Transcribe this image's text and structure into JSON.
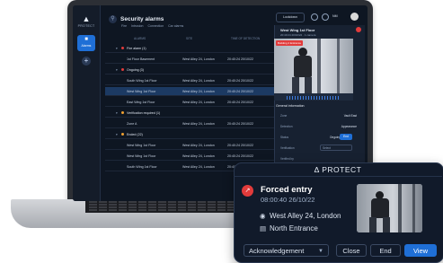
{
  "app": {
    "brand": "PROTECT"
  },
  "rail": {
    "alarms_label": "Alarms",
    "add_symbol": "+"
  },
  "list": {
    "title": "Security alarms",
    "legend": [
      "Fire",
      "Intrusion",
      "Connection",
      "Car alarms"
    ],
    "columns": [
      "ALARMS",
      "SITE",
      "TIME OF DETECTION",
      "STATUS"
    ],
    "rows": [
      {
        "kind": "group",
        "label": "Fire alarm (1)"
      },
      {
        "kind": "item",
        "name": "1st Floor Basement",
        "site": "West Alley 24, London",
        "time": "20:40:24 20/10/22"
      },
      {
        "kind": "group",
        "label": "Ongoing (3)"
      },
      {
        "kind": "item",
        "name": "South Wing 1st Floor",
        "site": "West Alley 24, London",
        "time": "20:40:24 20/10/22"
      },
      {
        "kind": "item",
        "name": "West Wing 1st Floor",
        "site": "West Alley 24, London",
        "time": "20:40:24 20/10/22",
        "selected": true
      },
      {
        "kind": "item",
        "name": "East Wing 1st Floor",
        "site": "West Alley 24, London",
        "time": "20:40:24 20/10/22"
      },
      {
        "kind": "group",
        "label": "Verification required (1)"
      },
      {
        "kind": "item",
        "name": "Zone A",
        "site": "West Alley 24, London",
        "time": "20:40:24 20/10/22"
      },
      {
        "kind": "group",
        "label": "Ended (22)"
      },
      {
        "kind": "item",
        "name": "West Wing 1st Floor",
        "site": "West Alley 24, London",
        "time": "20:40:24 20/10/22"
      },
      {
        "kind": "item",
        "name": "West Wing 1st Floor",
        "site": "West Alley 24, London",
        "time": "20:40:24 20/10/22"
      },
      {
        "kind": "item",
        "name": "South Wing 1st Floor",
        "site": "West Alley 24, London",
        "time": "20:40:24 20/10/22"
      }
    ]
  },
  "topbar": {
    "lockdown": "Lockdown",
    "user_initials": "NM"
  },
  "detail": {
    "title": "West Wing 1st Floor",
    "subtitle": "20:40:24 20/10/22 · 1 camera",
    "camera_badge": "Building 2 Entrance",
    "section": "General information",
    "fields": [
      {
        "label": "Zone",
        "value": "Vault East"
      },
      {
        "label": "Detection",
        "value": "Appearance"
      },
      {
        "label": "Status",
        "value": "Ongoing"
      },
      {
        "label": "Verification",
        "value": "Select"
      },
      {
        "label": "Verified by",
        "value": ""
      }
    ],
    "status_action": "End"
  },
  "card": {
    "brand": "PROTECT",
    "event_title": "Forced entry",
    "event_time": "08:00:40 26/10/22",
    "location": "West Alley 24, London",
    "door": "North Entrance",
    "acknowledgement": "Acknowledgement",
    "close": "Close",
    "end": "End",
    "view": "View"
  },
  "colors": {
    "accent": "#1f6fd6",
    "alarm": "#e23b3b",
    "panel_bg": "#0e1622"
  }
}
